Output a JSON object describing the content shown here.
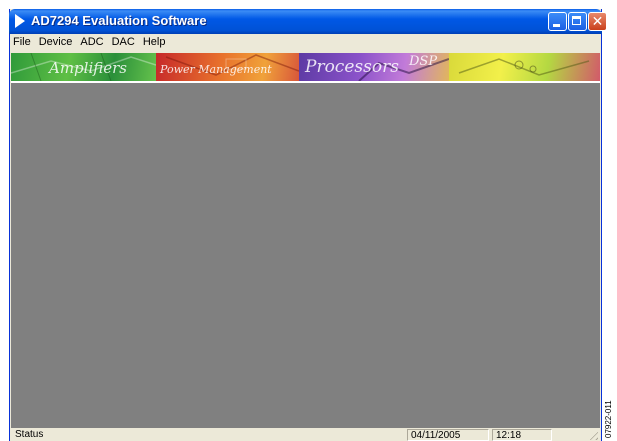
{
  "window": {
    "title": "AD7294 Evaluation Software",
    "icon": "play-arrow-icon",
    "accent_color": "#0058e6"
  },
  "titlebar_buttons": {
    "minimize_icon": "minimize-icon",
    "maximize_icon": "maximize-icon",
    "close_icon": "close-icon",
    "close_glyph": "✕"
  },
  "menu": {
    "items": [
      {
        "label": "File"
      },
      {
        "label": "Device"
      },
      {
        "label": "ADC"
      },
      {
        "label": "DAC"
      },
      {
        "label": "Help"
      }
    ]
  },
  "banner": {
    "panels": [
      {
        "label": "Amplifiers"
      },
      {
        "label": "Power Management"
      },
      {
        "label": "Processors"
      },
      {
        "label": "DSP"
      }
    ]
  },
  "workspace": {
    "background": "#808080"
  },
  "status": {
    "main": "Status",
    "date": "04/11/2005",
    "time": "12:18"
  },
  "figure_code": "07922-011"
}
